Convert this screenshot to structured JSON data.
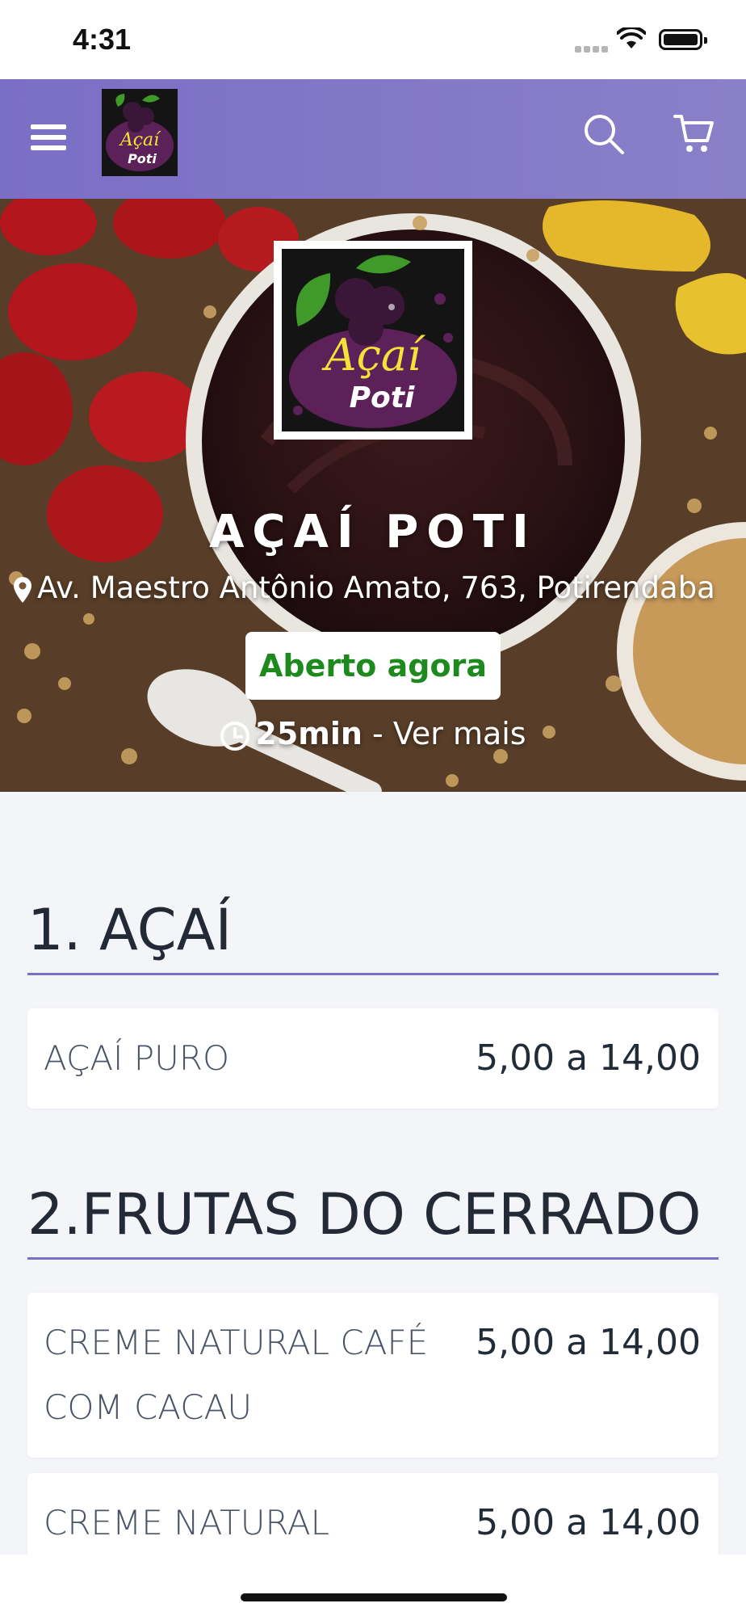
{
  "status_bar": {
    "time": "4:31"
  },
  "header": {
    "menu_icon": "hamburger-icon",
    "search_icon": "search-icon",
    "cart_icon": "cart-icon",
    "brand_color": "#7b6ec6"
  },
  "logo": {
    "line1": "Açaí",
    "line2": "Poti"
  },
  "store": {
    "name": "AÇAÍ POTI",
    "address": "Av. Maestro Antônio Amato, 763, Potirendaba",
    "status": "Aberto agora",
    "status_color": "#1e8a1e",
    "delivery_time": "25min",
    "see_more": "- Ver mais"
  },
  "categories": [
    {
      "title": "1. AÇAÍ",
      "items": [
        {
          "name": "AÇAÍ PURO",
          "price": "5,00 a 14,00"
        }
      ]
    },
    {
      "title": "2.FRUTAS DO CERRADO",
      "items": [
        {
          "name": "CREME NATURAL CAFÉ COM CACAU",
          "price": "5,00 a 14,00"
        },
        {
          "name": "CREME NATURAL",
          "price": "5,00 a 14,00"
        }
      ]
    }
  ]
}
